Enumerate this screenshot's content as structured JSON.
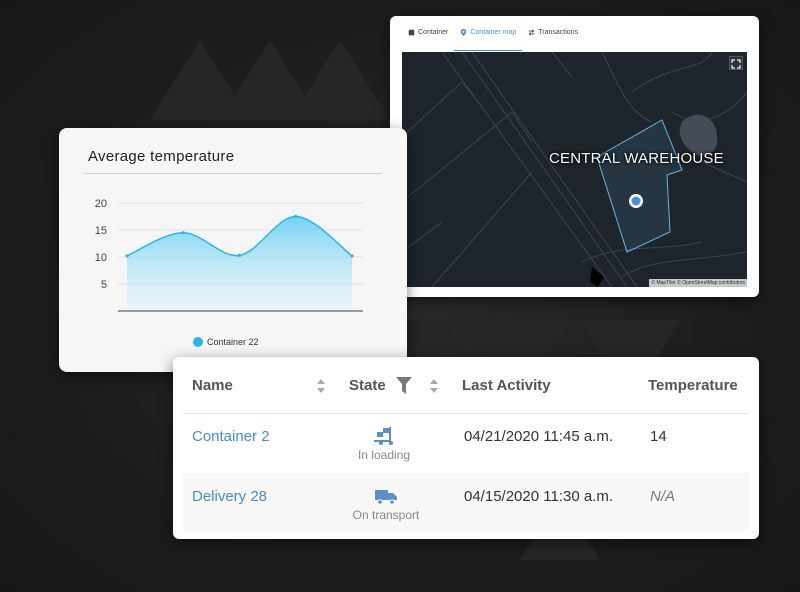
{
  "map_card": {
    "tabs": [
      {
        "label": "Container",
        "icon": "container-icon",
        "active": false
      },
      {
        "label": "Container map",
        "icon": "map-pin-icon",
        "active": true
      },
      {
        "label": "Transactions",
        "icon": "transfer-arrows-icon",
        "active": false
      }
    ],
    "location_label": "CENTRAL WAREHOUSE",
    "attribution": "© MapTiler © OpenStreetMap contributors",
    "accent_color": "#4a90d9",
    "geofence_color": "#5fb8e6"
  },
  "chart_card": {
    "title": "Average temperature",
    "legend_label": "Container 22",
    "chart_data": {
      "type": "area",
      "title": "Average temperature",
      "xlabel": "",
      "ylabel": "",
      "ylim": [
        0,
        20
      ],
      "yticks": [
        5,
        10,
        15,
        20
      ],
      "grid": true,
      "legend": "bottom",
      "x": [
        0,
        1,
        2,
        3,
        4
      ],
      "series": [
        {
          "name": "Container 22",
          "values": [
            10.2,
            14.5,
            10.3,
            17.5,
            10.2
          ],
          "color": "#26b6e8"
        }
      ]
    }
  },
  "table": {
    "headers": {
      "name": "Name",
      "state": "State",
      "last_activity": "Last Activity",
      "temperature": "Temperature"
    },
    "rows": [
      {
        "name": "Container 2",
        "state_icon": "loading-icon",
        "state": "In loading",
        "last_activity": "04/21/2020 11:45 a.m.",
        "temperature": "14"
      },
      {
        "name": "Delivery 28",
        "state_icon": "truck-icon",
        "state": "On transport",
        "last_activity": "04/15/2020 11:30 a.m.",
        "temperature": "N/A"
      }
    ],
    "link_color": "#4a8bc2",
    "icon_color": "#5c8fc7"
  }
}
